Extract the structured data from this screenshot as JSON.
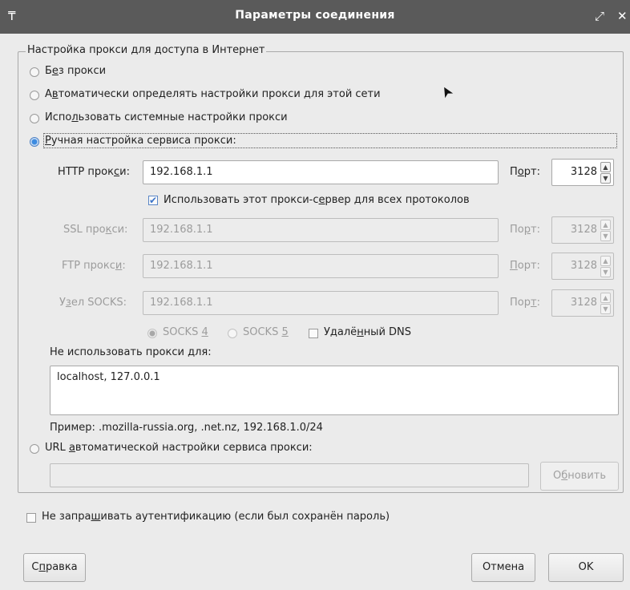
{
  "window": {
    "title": "Параметры соединения",
    "menu_icon": "₸",
    "maximize_icon": "⤢",
    "close_icon": "✕"
  },
  "proxy_group": {
    "legend": "Настройка прокси для доступа в Интернет"
  },
  "radios": {
    "no_proxy": {
      "pre": "Б",
      "acc": "е",
      "post": "з прокси"
    },
    "auto_detect": {
      "pre": "А",
      "acc": "в",
      "post": "томатически определять настройки прокси для этой сети"
    },
    "system": {
      "pre": "Испо",
      "acc": "л",
      "post": "ьзовать системные настройки прокси"
    },
    "manual": {
      "pre": "",
      "acc": "Р",
      "post": "учная настройка сервиса прокси:"
    },
    "auto_url": {
      "pre": "URL ",
      "acc": "а",
      "post": "втоматической настройки сервиса прокси:"
    }
  },
  "http": {
    "pre": "HTTP прок",
    "acc": "с",
    "post": "и:",
    "value": "192.168.1.1",
    "port_pre": "П",
    "port_acc": "о",
    "port_post": "рт:",
    "port": "3128"
  },
  "share_all": {
    "pre": "Использовать этот прокси-с",
    "acc": "е",
    "post": "рвер для всех протоколов"
  },
  "ssl": {
    "pre": "SSL про",
    "acc": "к",
    "post": "си:",
    "value": "192.168.1.1",
    "port_pre": "По",
    "port_acc": "р",
    "port_post": "т:",
    "port": "3128"
  },
  "ftp": {
    "pre": "FTP прокс",
    "acc": "и",
    "post": ":",
    "value": "192.168.1.1",
    "port_pre": "",
    "port_acc": "П",
    "port_post": "орт:",
    "port": "3128"
  },
  "socks": {
    "pre": "У",
    "acc": "з",
    "post": "ел SOCKS:",
    "value": "192.168.1.1",
    "port_pre": "Пор",
    "port_acc": "т",
    "port_post": ":",
    "port": "3128"
  },
  "socks_version": {
    "v4": {
      "pre": "SOCKS ",
      "acc": "4",
      "post": ""
    },
    "v5": {
      "pre": "SOCKS ",
      "acc": "5",
      "post": ""
    }
  },
  "remote_dns": {
    "pre": "Удалё",
    "acc": "н",
    "post": "ный DNS"
  },
  "no_proxy_for": {
    "pre": "Не использовать прокси ",
    "acc": "д",
    "post": "ля:",
    "value": "localhost, 127.0.0.1"
  },
  "example": "Пример: .mozilla-russia.org, .net.nz, 192.168.1.0/24",
  "auto_url_value": "",
  "reload_button": {
    "pre": "О",
    "acc": "б",
    "post": "новить"
  },
  "no_auth": {
    "pre": "Не запра",
    "acc": "ш",
    "post": "ивать аутентификацию (если был сохранён пароль)"
  },
  "help_button": {
    "pre": "С",
    "acc": "п",
    "post": "равка"
  },
  "cancel_button": "Отмена",
  "ok_button": "OK",
  "spin_up_icon": "▲",
  "spin_down_icon": "▼",
  "check_mark": "✔",
  "cursor_icon": "➤"
}
